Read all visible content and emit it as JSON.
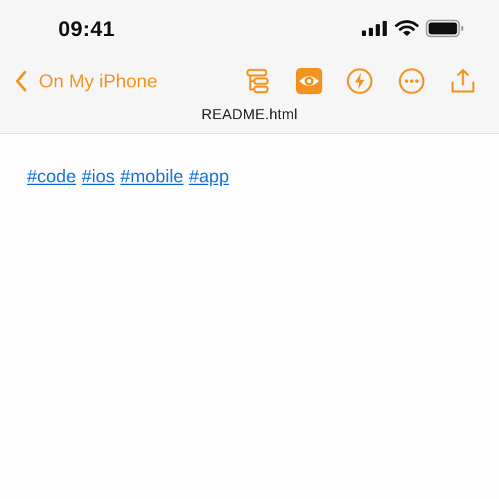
{
  "status": {
    "time": "09:41"
  },
  "nav": {
    "back_label": "On My iPhone",
    "toolbar": [
      {
        "name": "outline-icon"
      },
      {
        "name": "preview-eye-icon",
        "active": true
      },
      {
        "name": "lightning-icon"
      },
      {
        "name": "more-icon"
      },
      {
        "name": "share-icon"
      }
    ]
  },
  "document": {
    "file_name": "README.html",
    "tags": [
      "#code",
      "#ios",
      "#mobile",
      "#app"
    ]
  },
  "colors": {
    "accent": "#f39422",
    "link": "#1a73d9",
    "bar_background": "#f6f6f6",
    "page_background": "#fdfdfd"
  }
}
